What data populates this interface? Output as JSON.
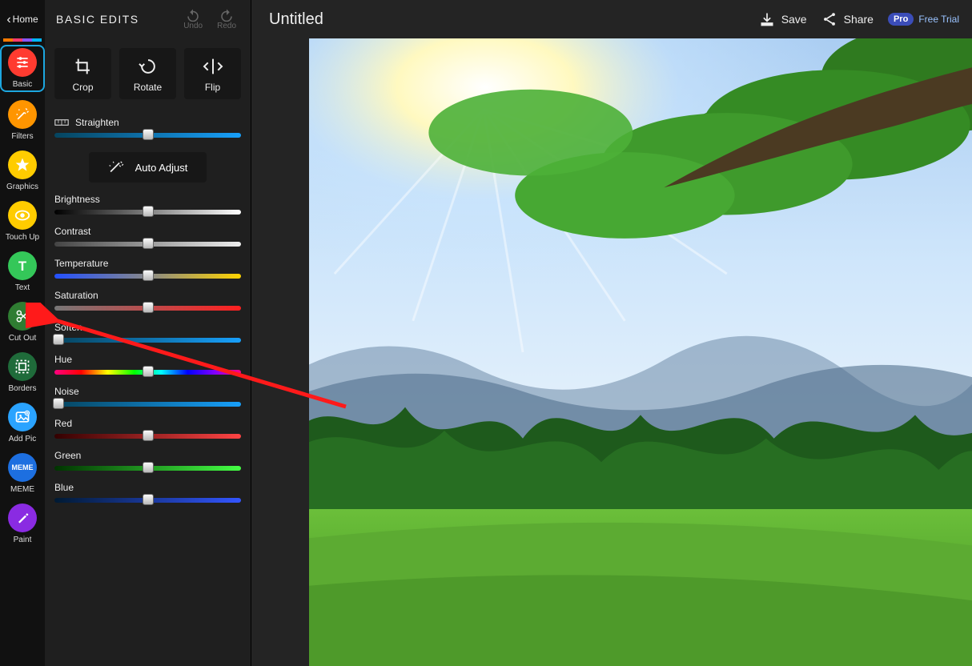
{
  "header": {
    "home_label": "Home",
    "panel_title": "BASIC EDITS",
    "undo_label": "Undo",
    "redo_label": "Redo"
  },
  "rail": {
    "items": [
      {
        "id": "basic",
        "label": "Basic",
        "color": "#ff3b30",
        "selected": true
      },
      {
        "id": "filters",
        "label": "Filters",
        "color": "#ff9500"
      },
      {
        "id": "graphics",
        "label": "Graphics",
        "color": "#ffcc00"
      },
      {
        "id": "touchup",
        "label": "Touch Up",
        "color": "#ffcc00"
      },
      {
        "id": "text",
        "label": "Text",
        "color": "#34c759"
      },
      {
        "id": "cutout",
        "label": "Cut Out",
        "color": "#2f7d32"
      },
      {
        "id": "borders",
        "label": "Borders",
        "color": "#1f6b3a"
      },
      {
        "id": "addpic",
        "label": "Add Pic",
        "color": "#2aa3ff"
      },
      {
        "id": "meme",
        "label": "MEME",
        "color": "#1d6fe0"
      },
      {
        "id": "paint",
        "label": "Paint",
        "color": "#8a2be2"
      }
    ]
  },
  "tools": {
    "crop": "Crop",
    "rotate": "Rotate",
    "flip": "Flip",
    "auto_adjust": "Auto Adjust"
  },
  "sliders": {
    "straighten": {
      "label": "Straighten",
      "pos": 50,
      "track": "tr-blue",
      "icon": true
    },
    "brightness": {
      "label": "Brightness",
      "pos": 50,
      "track": "tr-gray"
    },
    "contrast": {
      "label": "Contrast",
      "pos": 50,
      "track": "tr-contrast"
    },
    "temperature": {
      "label": "Temperature",
      "pos": 50,
      "track": "tr-temp"
    },
    "saturation": {
      "label": "Saturation",
      "pos": 50,
      "track": "tr-sat"
    },
    "soften": {
      "label": "Soften",
      "pos": 2,
      "track": "tr-blue"
    },
    "hue": {
      "label": "Hue",
      "pos": 50,
      "track": "tr-hue"
    },
    "noise": {
      "label": "Noise",
      "pos": 2,
      "track": "tr-blue"
    },
    "red": {
      "label": "Red",
      "pos": 50,
      "track": "tr-red"
    },
    "green": {
      "label": "Green",
      "pos": 50,
      "track": "tr-green"
    },
    "blue": {
      "label": "Blue",
      "pos": 50,
      "track": "tr-bluec"
    }
  },
  "main": {
    "title": "Untitled",
    "save": "Save",
    "share": "Share",
    "pro": "Pro",
    "trial": "Free Trial"
  },
  "annotation": {
    "target": "cutout"
  }
}
